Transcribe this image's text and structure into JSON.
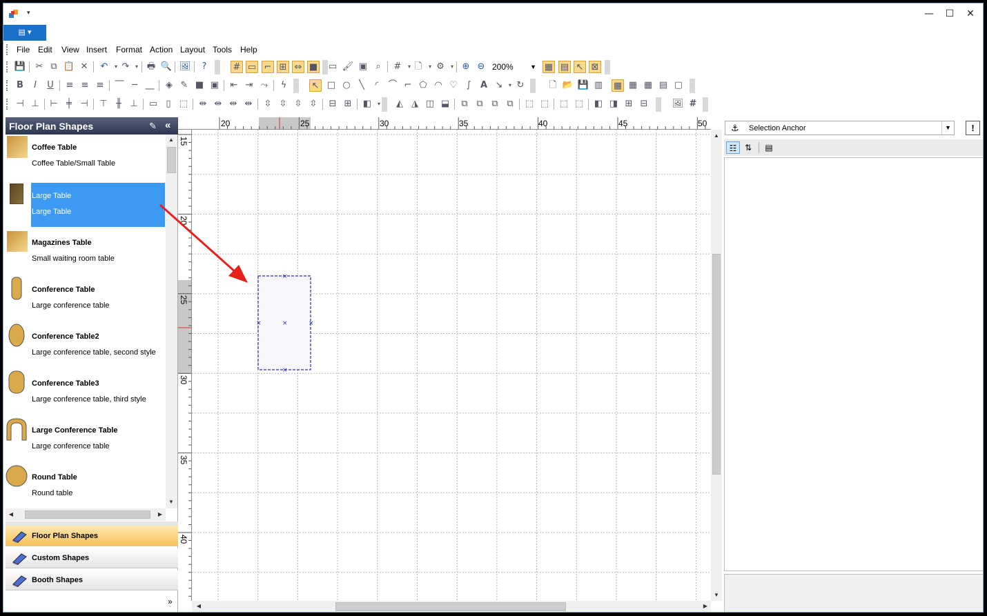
{
  "menu": [
    "File",
    "Edit",
    "View",
    "Insert",
    "Format",
    "Action",
    "Layout",
    "Tools",
    "Help"
  ],
  "toolbar": {
    "zoom_value": "200%"
  },
  "left_panel": {
    "title": "Floor Plan Shapes",
    "shapes": [
      {
        "name": "Coffee Table",
        "desc": "Coffee Table/Small Table",
        "icon": "coffee-table-icon"
      },
      {
        "name": "Large Table",
        "desc": "Large Table",
        "icon": "large-table-icon",
        "selected": true
      },
      {
        "name": "Magazines Table",
        "desc": "Small waiting room table",
        "icon": "magazines-table-icon"
      },
      {
        "name": "Conference Table",
        "desc": "Large conference table",
        "icon": "conference-table-icon"
      },
      {
        "name": "Conference Table2",
        "desc": "Large conference table, second style",
        "icon": "conference-table2-icon"
      },
      {
        "name": "Conference Table3",
        "desc": "Large conference table, third style",
        "icon": "conference-table3-icon"
      },
      {
        "name": "Large Conference Table",
        "desc": "Large conference table",
        "icon": "large-conference-table-icon"
      },
      {
        "name": "Round Table",
        "desc": "Round table",
        "icon": "round-table-icon"
      }
    ],
    "categories": [
      {
        "label": "Floor Plan Shapes",
        "active": true
      },
      {
        "label": "Custom Shapes",
        "active": false
      },
      {
        "label": "Booth Shapes",
        "active": false
      }
    ]
  },
  "rulers": {
    "horizontal": [
      "20",
      "25",
      "30",
      "35",
      "40",
      "45",
      "50"
    ],
    "vertical": [
      "15",
      "20",
      "25",
      "30",
      "35",
      "40"
    ]
  },
  "right_panel": {
    "selection_label": "Selection Anchor"
  },
  "colors": {
    "selection_blue": "#3d9af2",
    "app_button_blue": "#1a6fc9",
    "annotation_arrow_red": "#e8201c",
    "drag_outline": "#2a2ab0",
    "table_gold": "#d9a94a"
  }
}
